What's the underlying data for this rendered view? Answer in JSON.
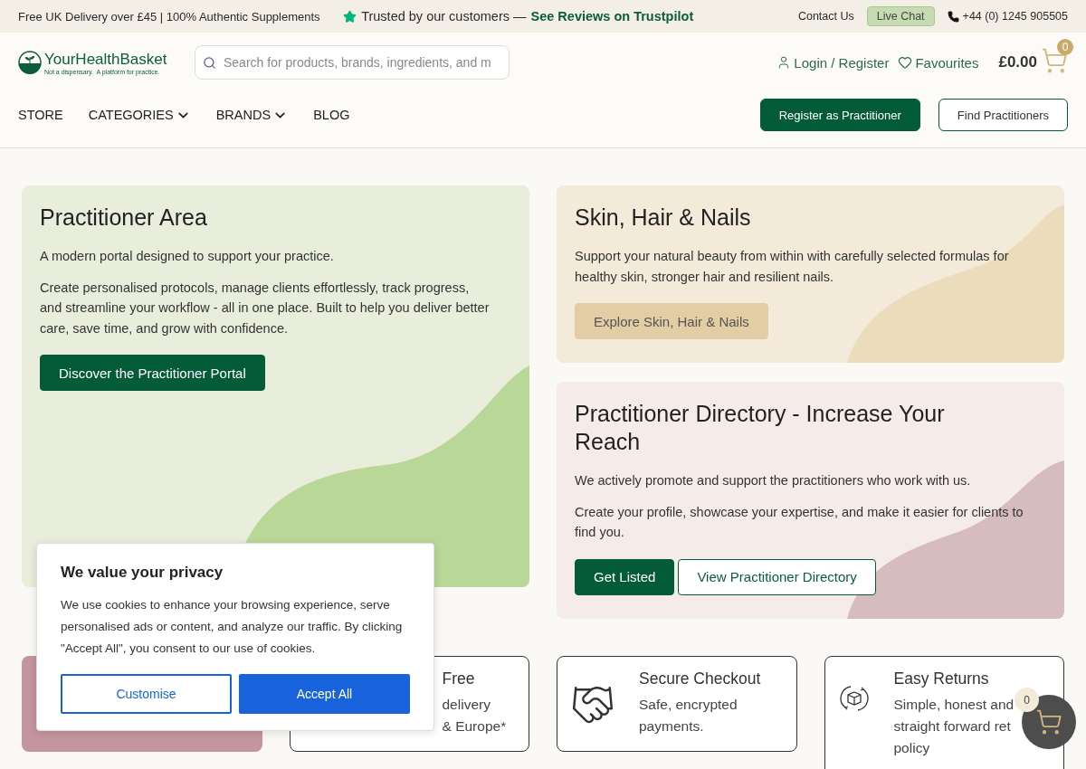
{
  "top_bar": {
    "promo": "Free UK Delivery over £45 | 100% Authentic Supplements",
    "trust_text": "Trusted by our customers —",
    "trust_link": "See Reviews on Trustpilot",
    "contact": "Contact Us",
    "live_chat": "Live Chat",
    "phone": "+44 (0) 1245 905505"
  },
  "header": {
    "logo_name": "YourHealthBasket",
    "logo_tagline": "Not a dispensary.  A platform for practice.",
    "search": {
      "placeholder": "Search for products, brands, ingredients, and m"
    },
    "account": [
      {
        "label": "Login / Register",
        "kind": "user"
      },
      {
        "label": "Favourites",
        "kind": "heart"
      }
    ],
    "cart": {
      "total": "£0.00",
      "count": "0"
    },
    "nav": [
      {
        "label": "STORE",
        "dropdown": false
      },
      {
        "label": "CATEGORIES",
        "dropdown": true
      },
      {
        "label": "BRANDS",
        "dropdown": true
      },
      {
        "label": "BLOG",
        "dropdown": false
      }
    ],
    "buttons": [
      {
        "label": "Register as Practitioner",
        "kind": "primary"
      },
      {
        "label": "Find Practitioners",
        "kind": "outline"
      }
    ]
  },
  "promo_cards": [
    {
      "title": "Practitioner Area",
      "color": "#e8eedb",
      "kind": "green",
      "paragraphs": [
        "A modern portal designed to support your practice.",
        "Create personalised protocols, manage clients effortlessly, track progress, and streamline your workflow - all in one place. Built to help you deliver better care, save time, and grow with confidence."
      ],
      "buttons": [
        {
          "label": "Discover the Practitioner Portal",
          "kind": "primary"
        }
      ]
    },
    {
      "title": "Skin, Hair & Nails",
      "color": "#f3ead9",
      "kind": "sand",
      "paragraphs": [
        "Support your natural beauty from within with carefully selected formulas for healthy skin, stronger hair and resilient nails."
      ],
      "buttons": [
        {
          "label": "Explore Skin, Hair & Nails",
          "kind": "tan"
        }
      ]
    },
    {
      "title": "Practitioner Directory - Increase Your Reach",
      "color": "#f5ebe9",
      "kind": "rose",
      "paragraphs": [
        "We actively promote and support the practitioners who work with us.",
        "Create your profile, showcase your expertise, and make it easier for clients to find you."
      ],
      "buttons": [
        {
          "label": "Get Listed",
          "kind": "primary"
        },
        {
          "label": "View Practitioner Directory",
          "kind": "outline"
        }
      ]
    }
  ],
  "features": [
    {
      "kind": "banner",
      "color": "#c3959f"
    },
    {
      "kind": "delivery",
      "title": "Free",
      "lines": [
        "delivery",
        "& Europe*"
      ]
    },
    {
      "kind": "checkout",
      "title": "Secure Checkout",
      "lines": [
        "Safe, encrypted",
        "payments."
      ]
    },
    {
      "kind": "returns",
      "title": "Easy Returns",
      "lines": [
        "Simple, honest and",
        "straight forward ret",
        "policy"
      ]
    }
  ],
  "cookie_dialog": {
    "title": "We value your privacy",
    "text": "We use cookies to enhance your browsing experience, serve personalised ads or content, and analyze our traffic. By clicking \"Accept All\", you consent to our use of cookies.",
    "buttons": [
      {
        "label": "Customise",
        "kind": "outline"
      },
      {
        "label": "Accept All",
        "kind": "primary"
      }
    ]
  },
  "floating_cart": {
    "count": "0"
  }
}
